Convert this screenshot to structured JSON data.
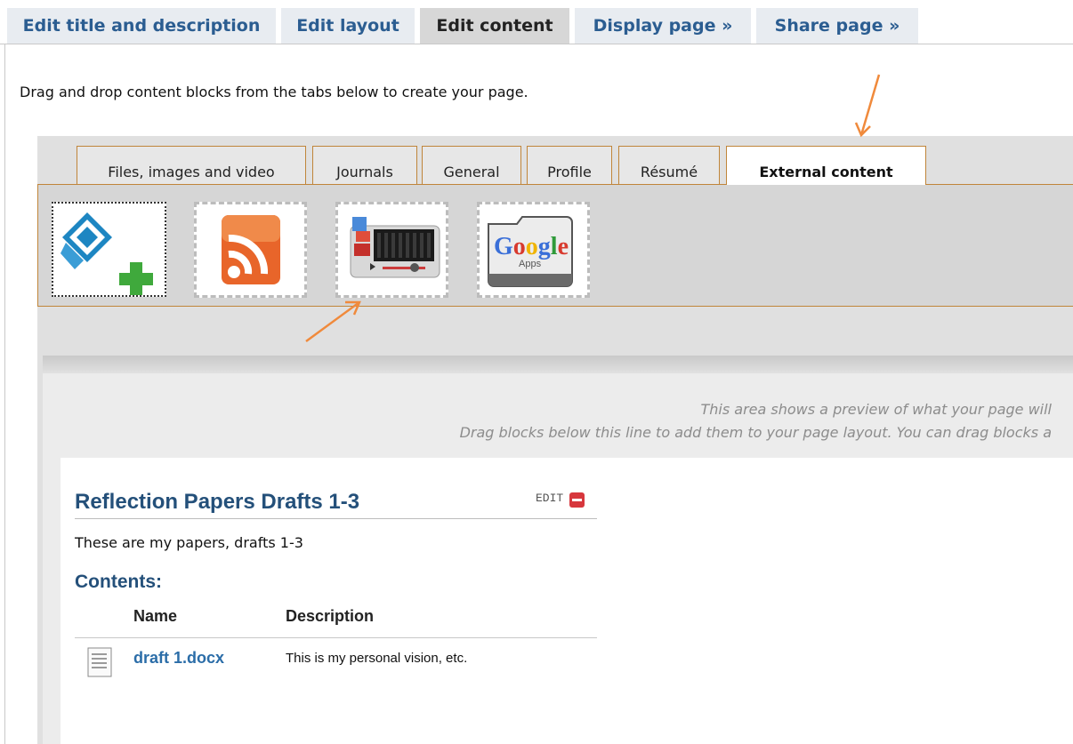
{
  "top_tabs": [
    {
      "label": "Edit title and description",
      "active": false
    },
    {
      "label": "Edit layout",
      "active": false
    },
    {
      "label": "Edit content",
      "active": true
    },
    {
      "label": "Display page »",
      "active": false
    },
    {
      "label": "Share page »",
      "active": false
    }
  ],
  "instructions": "Drag and drop content blocks from the tabs below to create your page.",
  "category_tabs": [
    {
      "label": "Files, images and video",
      "active": false
    },
    {
      "label": "Journals",
      "active": false
    },
    {
      "label": "General",
      "active": false
    },
    {
      "label": "Profile",
      "active": false
    },
    {
      "label": "Résumé",
      "active": false
    },
    {
      "label": "External content",
      "active": true
    }
  ],
  "blocks": [
    {
      "name": "embed-block",
      "icon": "embed-plus-icon"
    },
    {
      "name": "rss-block",
      "icon": "rss-icon"
    },
    {
      "name": "external-video-block",
      "icon": "video-player-icon"
    },
    {
      "name": "google-apps-block",
      "icon": "google-apps-icon"
    }
  ],
  "google_apps_logo": "Google Apps",
  "preview_hint_1": "This area shows a preview of what your page will",
  "preview_hint_2": "Drag blocks below this line to add them to your page layout. You can drag blocks a",
  "block": {
    "title": "Reflection Papers Drafts 1-3",
    "edit_label": "EDIT",
    "description": "These are my papers, drafts 1-3",
    "contents_heading": "Contents:",
    "columns": {
      "name": "Name",
      "description": "Description"
    },
    "files": [
      {
        "name": "draft 1.docx",
        "description": "This is my personal vision, etc."
      }
    ]
  },
  "colors": {
    "accent_link": "#2b5d91",
    "tab_border": "#c0853a",
    "annotation_arrow": "#f08a3c",
    "delete": "#d7373d"
  }
}
